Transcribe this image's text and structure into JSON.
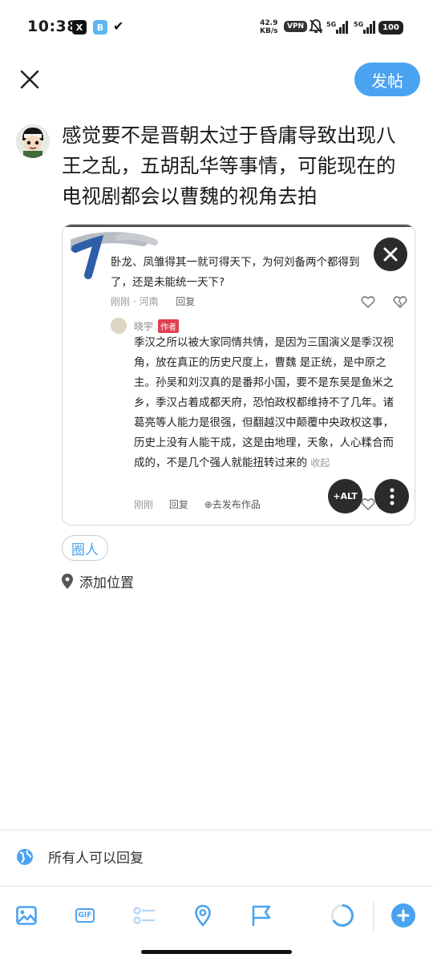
{
  "status_bar": {
    "time": "10:38",
    "net_speed_value": "42.9",
    "net_speed_unit": "KB/s",
    "vpn": "VPN",
    "sig1": "5G",
    "sig2": "5G",
    "battery": "100"
  },
  "header": {
    "post_label": "发帖"
  },
  "composer": {
    "text": "感觉要不是晋朝太过于昏庸导致出现八王之乱，五胡乱华等事情，可能现在的电视剧都会以曹魏的视角去拍"
  },
  "attachment": {
    "question": "卧龙、凤雏得其一就可得天下，为何刘备两个都得到了，还是未能统一天下?",
    "question_time_loc": "刚刚 · 河南",
    "question_reply": "回复",
    "reply_name": "晓宇",
    "author_badge": "作者",
    "reply_body": "季汉之所以被大家同情共情，是因为三国演义是季汉视角，放在真正的历史尺度上，曹魏 是正统，是中原之主。孙吴和刘汉真的是番邦小国，要不是东吴是鱼米之乡，季汉占着成都天府，恐怕政权都维持不了几年。诸葛亮等人能力是很强，但翻越汉中颠覆中央政权这事，历史上没有人能干成，这是由地理，天象，人心糅合而成的，不是几个强人就能扭转过来的",
    "fold": "收起",
    "reply_time": "刚刚",
    "reply_reply": "回复",
    "publish_work": "去发布作品",
    "alt_label": "+ALT"
  },
  "tag_chip": "圈人",
  "location": "添加位置",
  "reply_permission": "所有人可以回复",
  "toolbar": {
    "gif_label": "GIF",
    "icons": [
      "image-icon",
      "gif-icon",
      "poll-icon",
      "location-icon",
      "flag-icon",
      "progress-ring-icon",
      "add-icon"
    ]
  },
  "colors": {
    "accent": "#4aa3f0",
    "badge": "#e04050"
  }
}
